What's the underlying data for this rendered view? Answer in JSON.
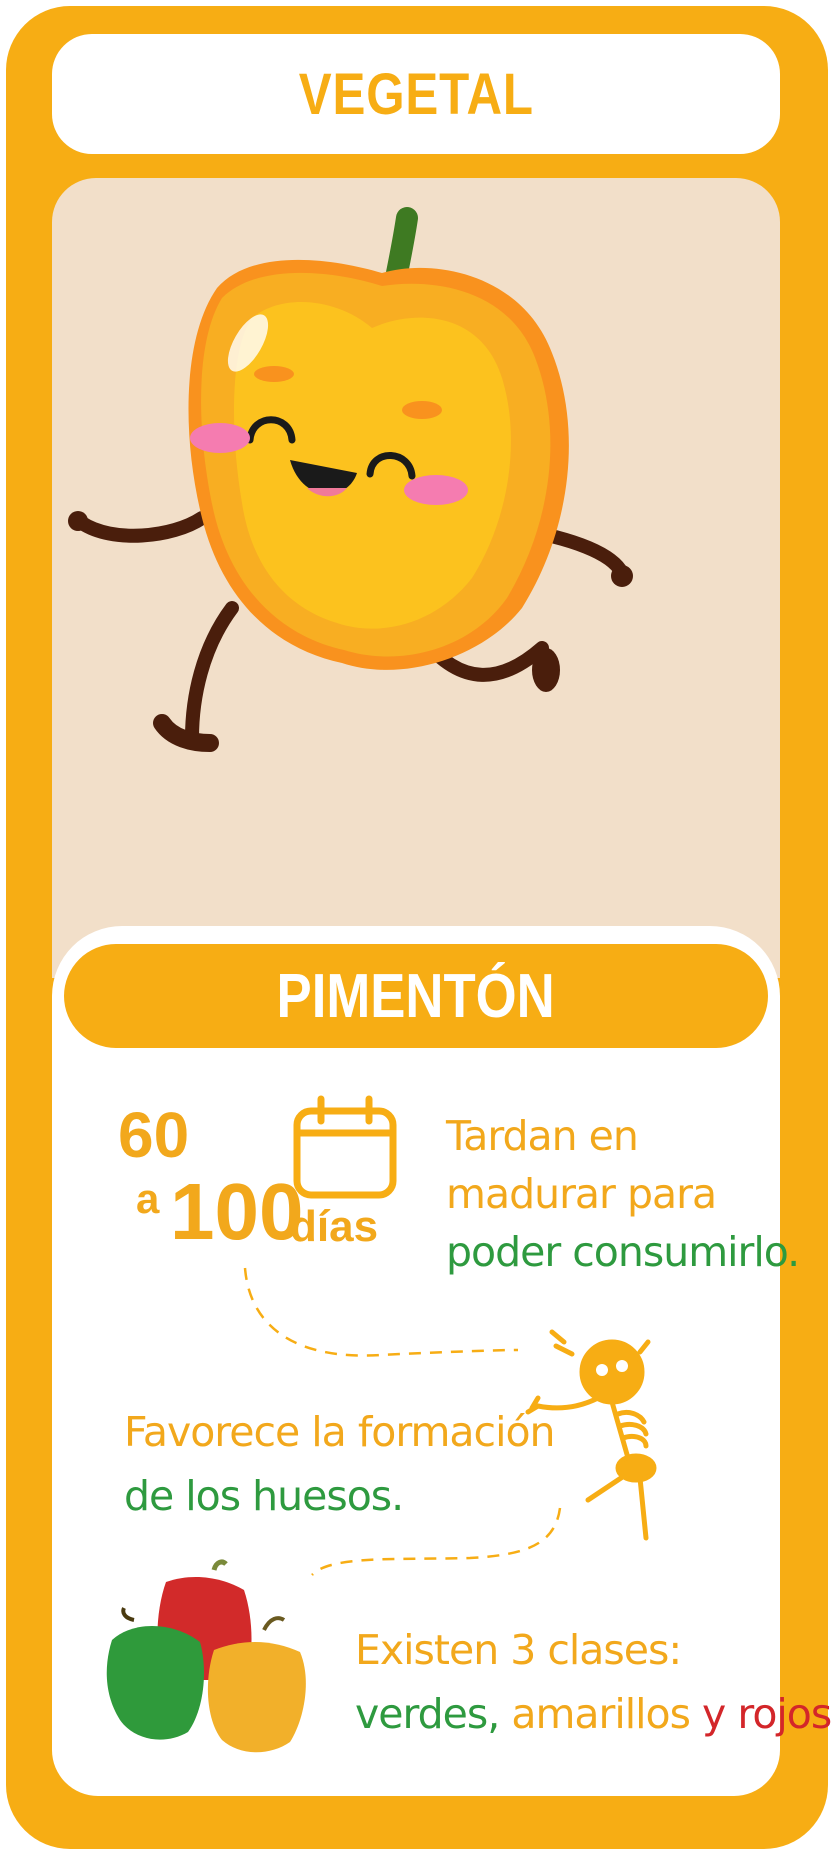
{
  "header": {
    "title": "VEGETAL"
  },
  "name": "PIMENTÓN",
  "ripening": {
    "from": "60",
    "connector": "a",
    "to": "100",
    "unit": "días",
    "line1": "Tardan en",
    "line2": "madurar para",
    "line3": "poder consumirlo."
  },
  "bones": {
    "line1": "Favorece la formación",
    "line2": "de los huesos."
  },
  "classes": {
    "line1": "Existen 3 clases:",
    "green_word": "verdes,",
    "yellow_word": "amarillos",
    "y_word": "y",
    "red_word": "rojos."
  },
  "colors": {
    "frame": "#F7AD14",
    "art_background": "#F2DFC9",
    "text_orange": "#F2A81C",
    "text_green": "#2E9A3F",
    "text_red": "#D3262A"
  },
  "icons": [
    "pepper-mascot",
    "calendar-icon",
    "skeleton-icon",
    "peppers-group-icon"
  ]
}
